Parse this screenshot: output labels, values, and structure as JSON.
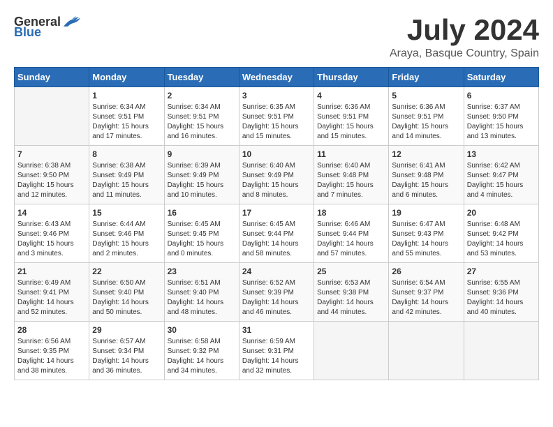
{
  "logo": {
    "general": "General",
    "blue": "Blue"
  },
  "header": {
    "month": "July 2024",
    "location": "Araya, Basque Country, Spain"
  },
  "weekdays": [
    "Sunday",
    "Monday",
    "Tuesday",
    "Wednesday",
    "Thursday",
    "Friday",
    "Saturday"
  ],
  "weeks": [
    [
      {
        "day": "",
        "empty": true
      },
      {
        "day": "1",
        "sunrise": "6:34 AM",
        "sunset": "9:51 PM",
        "daylight": "15 hours and 17 minutes."
      },
      {
        "day": "2",
        "sunrise": "6:34 AM",
        "sunset": "9:51 PM",
        "daylight": "15 hours and 16 minutes."
      },
      {
        "day": "3",
        "sunrise": "6:35 AM",
        "sunset": "9:51 PM",
        "daylight": "15 hours and 15 minutes."
      },
      {
        "day": "4",
        "sunrise": "6:36 AM",
        "sunset": "9:51 PM",
        "daylight": "15 hours and 15 minutes."
      },
      {
        "day": "5",
        "sunrise": "6:36 AM",
        "sunset": "9:51 PM",
        "daylight": "15 hours and 14 minutes."
      },
      {
        "day": "6",
        "sunrise": "6:37 AM",
        "sunset": "9:50 PM",
        "daylight": "15 hours and 13 minutes."
      }
    ],
    [
      {
        "day": "7",
        "sunrise": "6:38 AM",
        "sunset": "9:50 PM",
        "daylight": "15 hours and 12 minutes."
      },
      {
        "day": "8",
        "sunrise": "6:38 AM",
        "sunset": "9:49 PM",
        "daylight": "15 hours and 11 minutes."
      },
      {
        "day": "9",
        "sunrise": "6:39 AM",
        "sunset": "9:49 PM",
        "daylight": "15 hours and 10 minutes."
      },
      {
        "day": "10",
        "sunrise": "6:40 AM",
        "sunset": "9:49 PM",
        "daylight": "15 hours and 8 minutes."
      },
      {
        "day": "11",
        "sunrise": "6:40 AM",
        "sunset": "9:48 PM",
        "daylight": "15 hours and 7 minutes."
      },
      {
        "day": "12",
        "sunrise": "6:41 AM",
        "sunset": "9:48 PM",
        "daylight": "15 hours and 6 minutes."
      },
      {
        "day": "13",
        "sunrise": "6:42 AM",
        "sunset": "9:47 PM",
        "daylight": "15 hours and 4 minutes."
      }
    ],
    [
      {
        "day": "14",
        "sunrise": "6:43 AM",
        "sunset": "9:46 PM",
        "daylight": "15 hours and 3 minutes."
      },
      {
        "day": "15",
        "sunrise": "6:44 AM",
        "sunset": "9:46 PM",
        "daylight": "15 hours and 2 minutes."
      },
      {
        "day": "16",
        "sunrise": "6:45 AM",
        "sunset": "9:45 PM",
        "daylight": "15 hours and 0 minutes."
      },
      {
        "day": "17",
        "sunrise": "6:45 AM",
        "sunset": "9:44 PM",
        "daylight": "14 hours and 58 minutes."
      },
      {
        "day": "18",
        "sunrise": "6:46 AM",
        "sunset": "9:44 PM",
        "daylight": "14 hours and 57 minutes."
      },
      {
        "day": "19",
        "sunrise": "6:47 AM",
        "sunset": "9:43 PM",
        "daylight": "14 hours and 55 minutes."
      },
      {
        "day": "20",
        "sunrise": "6:48 AM",
        "sunset": "9:42 PM",
        "daylight": "14 hours and 53 minutes."
      }
    ],
    [
      {
        "day": "21",
        "sunrise": "6:49 AM",
        "sunset": "9:41 PM",
        "daylight": "14 hours and 52 minutes."
      },
      {
        "day": "22",
        "sunrise": "6:50 AM",
        "sunset": "9:40 PM",
        "daylight": "14 hours and 50 minutes."
      },
      {
        "day": "23",
        "sunrise": "6:51 AM",
        "sunset": "9:40 PM",
        "daylight": "14 hours and 48 minutes."
      },
      {
        "day": "24",
        "sunrise": "6:52 AM",
        "sunset": "9:39 PM",
        "daylight": "14 hours and 46 minutes."
      },
      {
        "day": "25",
        "sunrise": "6:53 AM",
        "sunset": "9:38 PM",
        "daylight": "14 hours and 44 minutes."
      },
      {
        "day": "26",
        "sunrise": "6:54 AM",
        "sunset": "9:37 PM",
        "daylight": "14 hours and 42 minutes."
      },
      {
        "day": "27",
        "sunrise": "6:55 AM",
        "sunset": "9:36 PM",
        "daylight": "14 hours and 40 minutes."
      }
    ],
    [
      {
        "day": "28",
        "sunrise": "6:56 AM",
        "sunset": "9:35 PM",
        "daylight": "14 hours and 38 minutes."
      },
      {
        "day": "29",
        "sunrise": "6:57 AM",
        "sunset": "9:34 PM",
        "daylight": "14 hours and 36 minutes."
      },
      {
        "day": "30",
        "sunrise": "6:58 AM",
        "sunset": "9:32 PM",
        "daylight": "14 hours and 34 minutes."
      },
      {
        "day": "31",
        "sunrise": "6:59 AM",
        "sunset": "9:31 PM",
        "daylight": "14 hours and 32 minutes."
      },
      {
        "day": "",
        "empty": true
      },
      {
        "day": "",
        "empty": true
      },
      {
        "day": "",
        "empty": true
      }
    ]
  ]
}
